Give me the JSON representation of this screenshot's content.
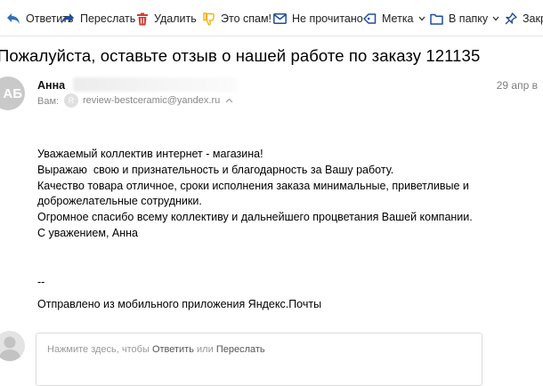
{
  "toolbar": {
    "items": [
      {
        "label": "Ответить",
        "icon": "reply-icon"
      },
      {
        "label": "Переслать",
        "icon": "forward-icon"
      },
      {
        "label": "Удалить",
        "icon": "trash-icon"
      },
      {
        "label": "Это спам!",
        "icon": "thumb-down-icon"
      },
      {
        "label": "Не прочитано",
        "icon": "envelope-icon"
      },
      {
        "label": "Метка",
        "icon": "label-tag-icon"
      },
      {
        "label": "В папку",
        "icon": "folder-icon"
      },
      {
        "label": "Закреп",
        "icon": "pin-icon"
      }
    ],
    "colors": {
      "reply": "#2f6fbf",
      "delete": "#d63b2f",
      "spam": "#f0b400",
      "neutral": "#1f4e9e"
    }
  },
  "message": {
    "subject": "Пожалуйста, оставьте отзыв о нашей работе по заказу 121135",
    "sender": {
      "name": "Анна",
      "avatar_initials": "АБ",
      "date": "29 апр в"
    },
    "to_label": "Вам:",
    "to_address": "review-bestceramic@yandex.ru",
    "to_avatar_initial": "R",
    "body_lines": [
      "Уважаемый коллектив интернет - магазина!",
      "Выражаю  свою и признательность и благодарность за Вашу работу.",
      "Качество товара отличное, сроки исполнения заказа минимальные, приветливые и",
      "доброжелательные сотрудники.",
      "Огромное спасибо всему коллективу и дальнейшего процветания Вашей компании.",
      "С уважением, Анна"
    ],
    "signature_lines": [
      "--",
      "Отправлено из мобильного приложения Яндекс.Почты"
    ]
  },
  "reply_box": {
    "hint_prefix": "Нажмите здесь, чтобы",
    "reply_link": "Ответить",
    "or_word": "или",
    "forward_link": "Переслать"
  }
}
